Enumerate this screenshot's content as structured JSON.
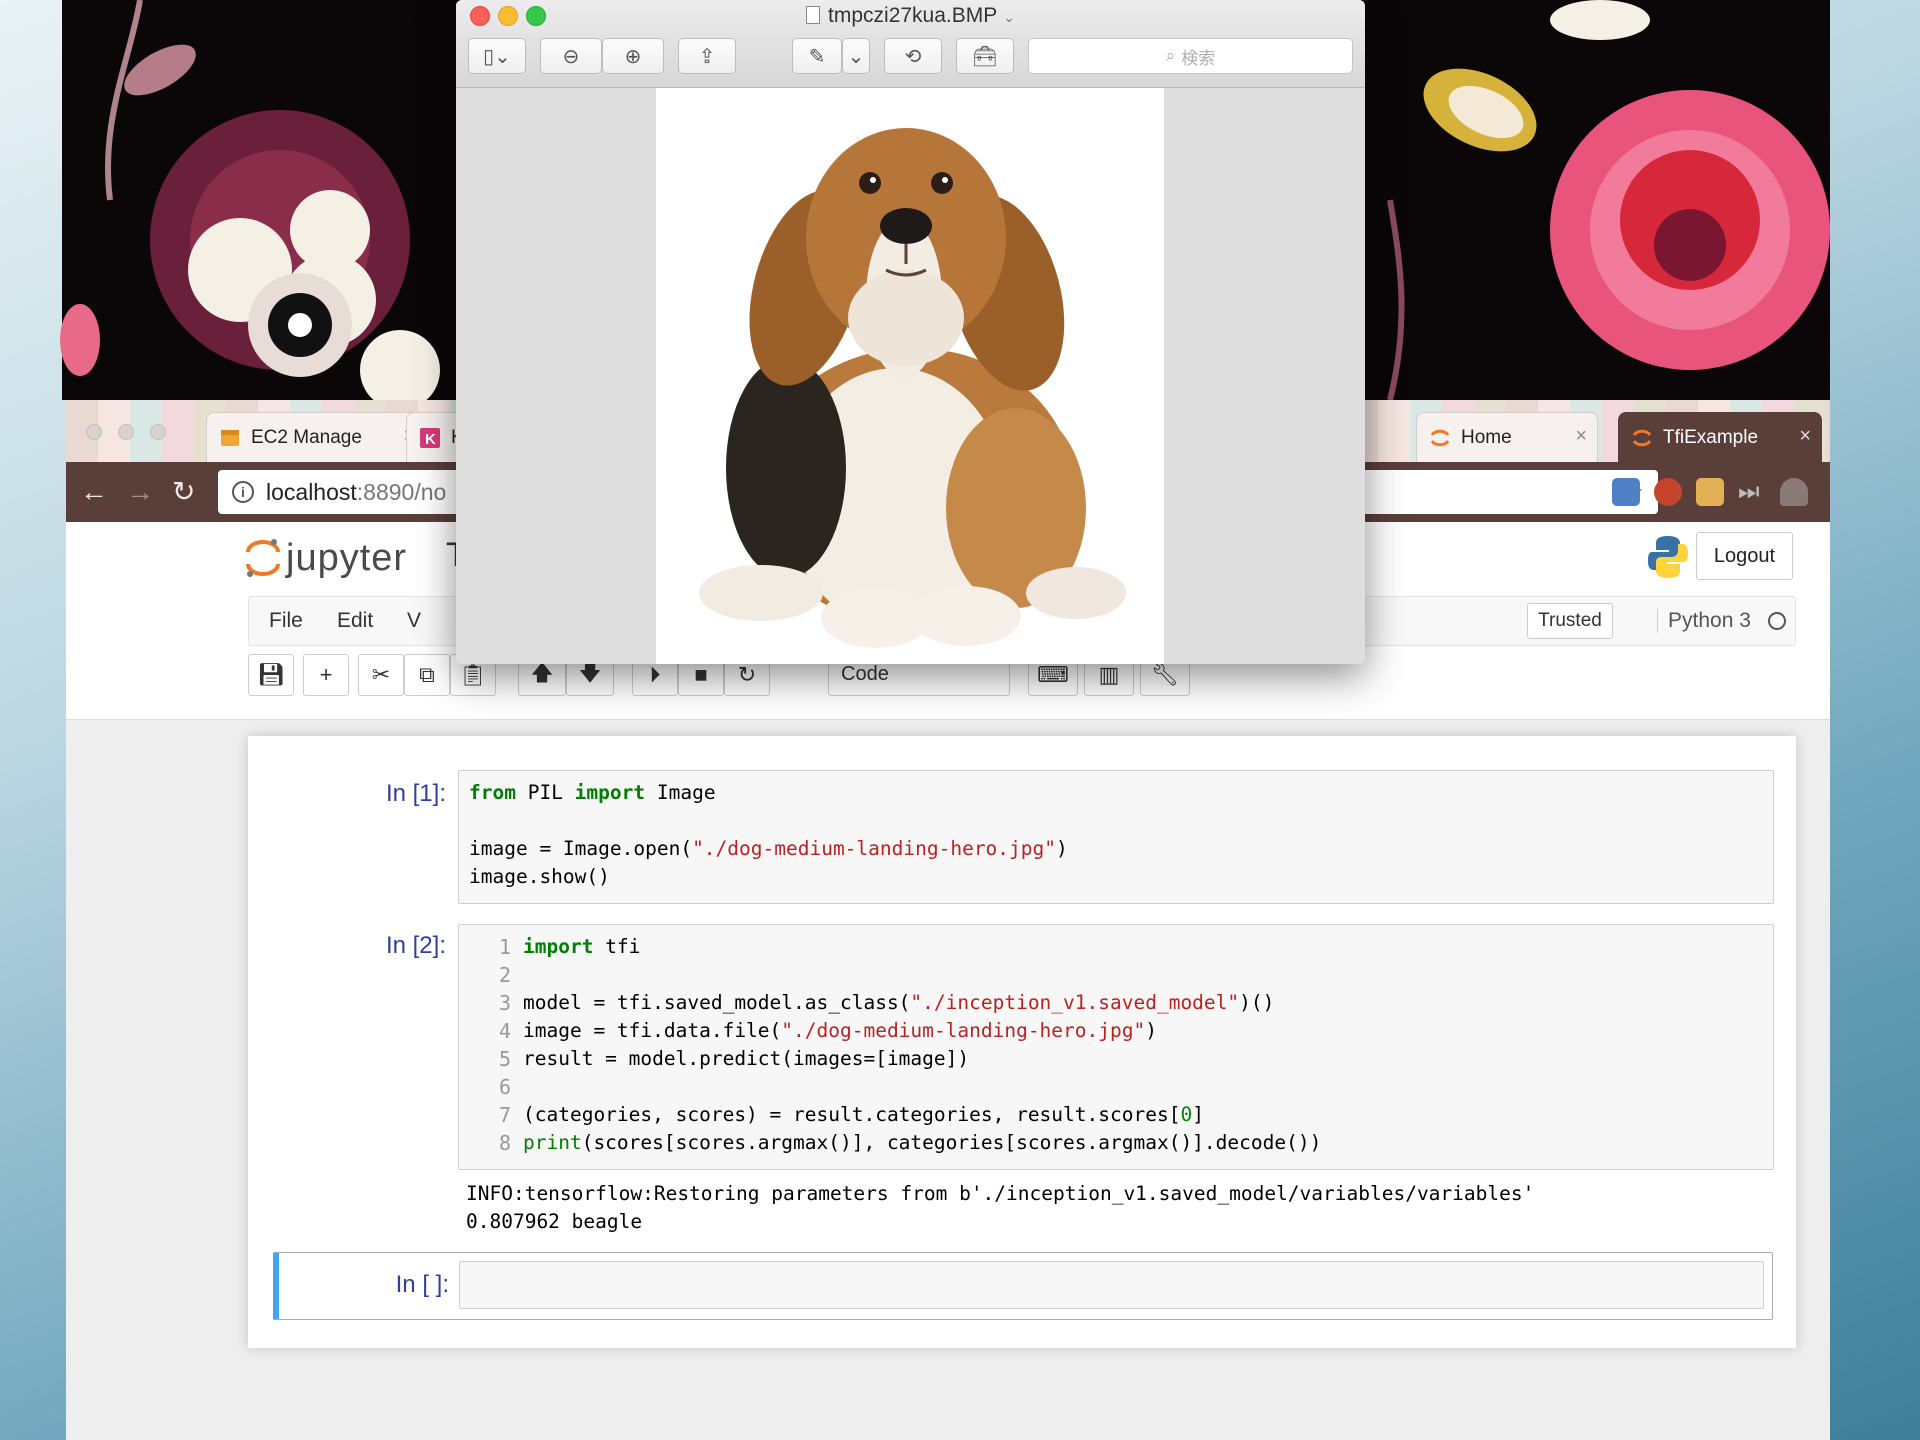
{
  "preview": {
    "filename": "tmpczi27kua.BMP",
    "search_placeholder": "検索"
  },
  "browser": {
    "tabs": [
      {
        "label": "EC2 Manage"
      },
      {
        "label": "K"
      },
      {
        "label": "Home"
      },
      {
        "label": "TfiExample"
      }
    ],
    "url_host": "localhost",
    "url_path": ":8890/no"
  },
  "jupyter": {
    "logo_text": "jupyter",
    "title_fragment": "T",
    "logout_label": "Logout",
    "menu": [
      "File",
      "Edit",
      "V"
    ],
    "trusted_label": "Trusted",
    "kernel_name": "Python 3",
    "cell_type": "Code"
  },
  "cells": [
    {
      "prompt": "In [1]:",
      "lines": [
        "from PIL import Image",
        "",
        "image = Image.open(\"./dog-medium-landing-hero.jpg\")",
        "image.show()"
      ]
    },
    {
      "prompt": "In [2]:",
      "line_numbers": [
        "1",
        "2",
        "3",
        "4",
        "5",
        "6",
        "7",
        "8"
      ],
      "lines": [
        "import tfi",
        "",
        "model = tfi.saved_model.as_class(\"./inception_v1.saved_model\")()",
        "image = tfi.data.file(\"./dog-medium-landing-hero.jpg\")",
        "result = model.predict(images=[image])",
        "",
        "(categories, scores) = result.categories, result.scores[0]",
        "print(scores[scores.argmax()], categories[scores.argmax()].decode())"
      ],
      "output": [
        "INFO:tensorflow:Restoring parameters from b'./inception_v1.saved_model/variables/variables'",
        "0.807962 beagle"
      ]
    },
    {
      "prompt": "In [ ]:"
    }
  ],
  "colors": {
    "tab_active": "#5a3e39",
    "prompt_blue": "#303f9f",
    "keyword_green": "#008000",
    "string_red": "#ba2121",
    "selected_cell_bar": "#42a5f5"
  }
}
